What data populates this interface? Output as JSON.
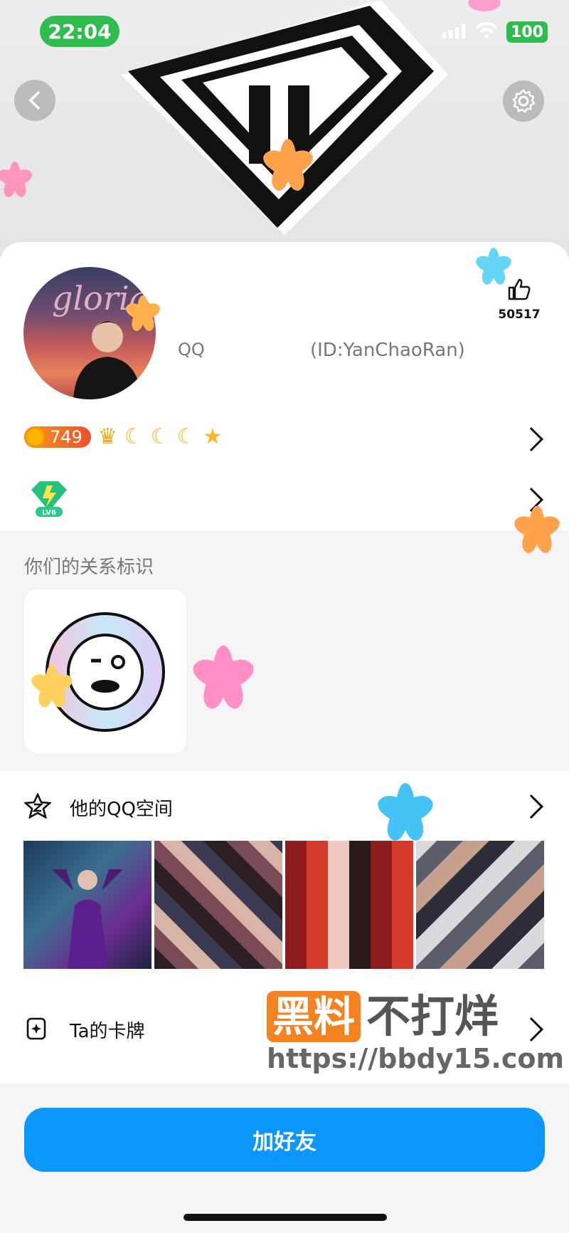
{
  "status": {
    "time": "22:04",
    "battery": "100"
  },
  "profile": {
    "name": "QQ",
    "id_text": "(ID:YanChaoRan)",
    "likes": "50517",
    "coins": "749"
  },
  "relation": {
    "title": "你们的关系标识"
  },
  "qzone": {
    "title": "他的QQ空间"
  },
  "card_section": {
    "title": "Ta的卡牌"
  },
  "watermark": {
    "url": "https://bbdy15.com",
    "brand_left": "黑料",
    "brand_right": "不打烊"
  },
  "add_friend": {
    "label": "加好友"
  },
  "colors": {
    "accent": "#0b97ff",
    "status_green": "#2fbd4f",
    "coin": "#ef4f2a"
  }
}
